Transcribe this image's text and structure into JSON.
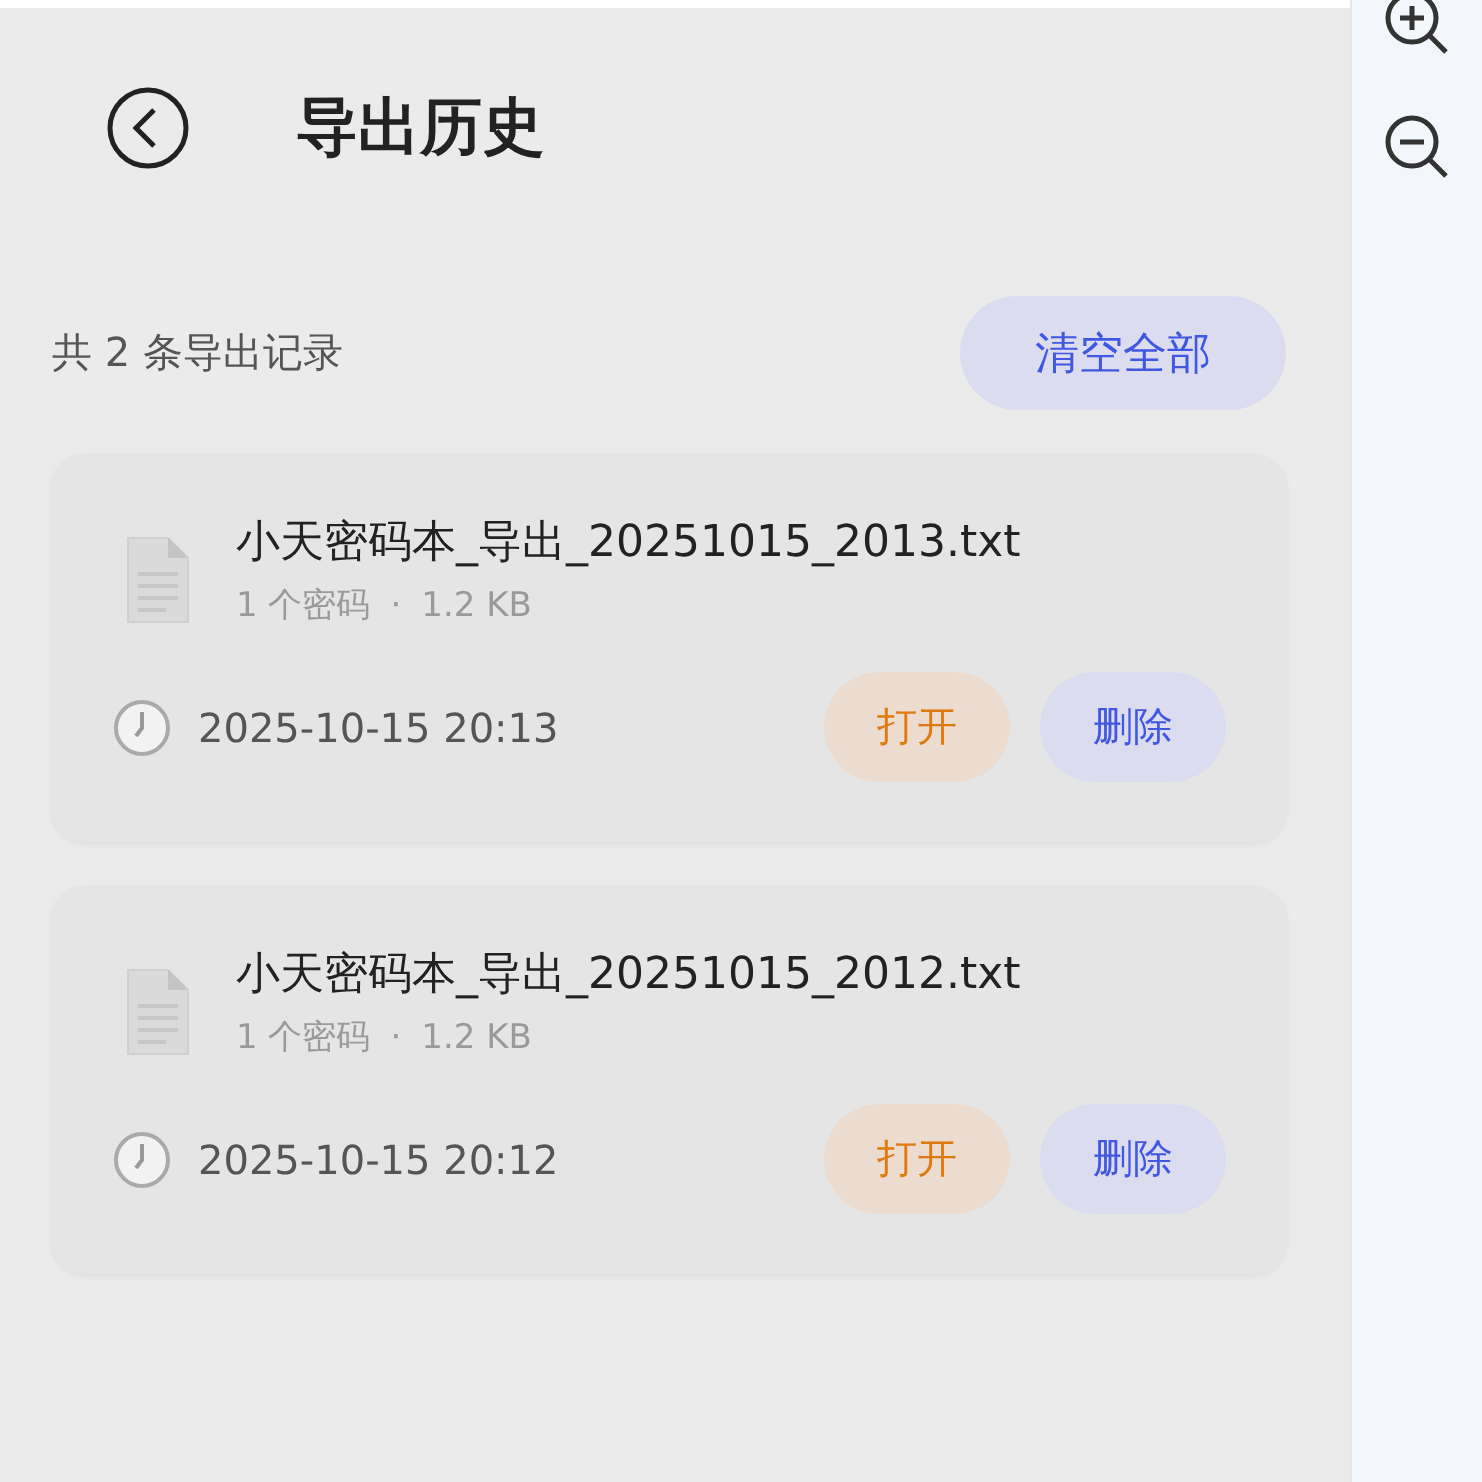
{
  "header": {
    "title": "导出历史"
  },
  "summary": {
    "text": "共 2 条导出记录",
    "clear_button": "清空全部"
  },
  "records": [
    {
      "filename": "小天密码本_导出_20251015_2013.txt",
      "count": "1 个密码",
      "separator": "·",
      "size": "1.2 KB",
      "time": "2025-10-15 20:13",
      "open_button": "打开",
      "delete_button": "删除"
    },
    {
      "filename": "小天密码本_导出_20251015_2012.txt",
      "count": "1 个密码",
      "separator": "·",
      "size": "1.2 KB",
      "time": "2025-10-15 20:12",
      "open_button": "打开",
      "delete_button": "删除"
    }
  ]
}
